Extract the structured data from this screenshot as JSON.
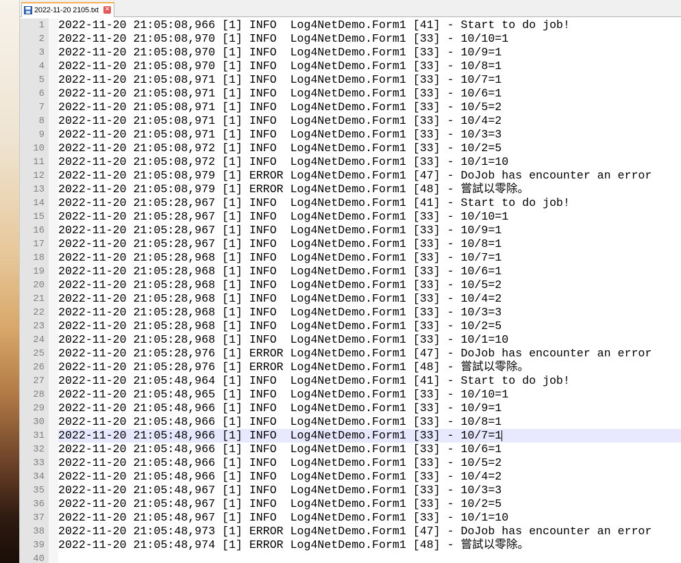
{
  "tab": {
    "title": "2022-11-20 2105.txt",
    "close_symbol": "✕"
  },
  "current_line": 31,
  "lines": [
    "2022-11-20 21:05:08,966 [1] INFO  Log4NetDemo.Form1 [41] - Start to do job!",
    "2022-11-20 21:05:08,970 [1] INFO  Log4NetDemo.Form1 [33] - 10/10=1",
    "2022-11-20 21:05:08,970 [1] INFO  Log4NetDemo.Form1 [33] - 10/9=1",
    "2022-11-20 21:05:08,970 [1] INFO  Log4NetDemo.Form1 [33] - 10/8=1",
    "2022-11-20 21:05:08,971 [1] INFO  Log4NetDemo.Form1 [33] - 10/7=1",
    "2022-11-20 21:05:08,971 [1] INFO  Log4NetDemo.Form1 [33] - 10/6=1",
    "2022-11-20 21:05:08,971 [1] INFO  Log4NetDemo.Form1 [33] - 10/5=2",
    "2022-11-20 21:05:08,971 [1] INFO  Log4NetDemo.Form1 [33] - 10/4=2",
    "2022-11-20 21:05:08,971 [1] INFO  Log4NetDemo.Form1 [33] - 10/3=3",
    "2022-11-20 21:05:08,972 [1] INFO  Log4NetDemo.Form1 [33] - 10/2=5",
    "2022-11-20 21:05:08,972 [1] INFO  Log4NetDemo.Form1 [33] - 10/1=10",
    "2022-11-20 21:05:08,979 [1] ERROR Log4NetDemo.Form1 [47] - DoJob has encounter an error",
    "2022-11-20 21:05:08,979 [1] ERROR Log4NetDemo.Form1 [48] - 嘗試以零除。",
    "2022-11-20 21:05:28,967 [1] INFO  Log4NetDemo.Form1 [41] - Start to do job!",
    "2022-11-20 21:05:28,967 [1] INFO  Log4NetDemo.Form1 [33] - 10/10=1",
    "2022-11-20 21:05:28,967 [1] INFO  Log4NetDemo.Form1 [33] - 10/9=1",
    "2022-11-20 21:05:28,967 [1] INFO  Log4NetDemo.Form1 [33] - 10/8=1",
    "2022-11-20 21:05:28,968 [1] INFO  Log4NetDemo.Form1 [33] - 10/7=1",
    "2022-11-20 21:05:28,968 [1] INFO  Log4NetDemo.Form1 [33] - 10/6=1",
    "2022-11-20 21:05:28,968 [1] INFO  Log4NetDemo.Form1 [33] - 10/5=2",
    "2022-11-20 21:05:28,968 [1] INFO  Log4NetDemo.Form1 [33] - 10/4=2",
    "2022-11-20 21:05:28,968 [1] INFO  Log4NetDemo.Form1 [33] - 10/3=3",
    "2022-11-20 21:05:28,968 [1] INFO  Log4NetDemo.Form1 [33] - 10/2=5",
    "2022-11-20 21:05:28,968 [1] INFO  Log4NetDemo.Form1 [33] - 10/1=10",
    "2022-11-20 21:05:28,976 [1] ERROR Log4NetDemo.Form1 [47] - DoJob has encounter an error",
    "2022-11-20 21:05:28,976 [1] ERROR Log4NetDemo.Form1 [48] - 嘗試以零除。",
    "2022-11-20 21:05:48,964 [1] INFO  Log4NetDemo.Form1 [41] - Start to do job!",
    "2022-11-20 21:05:48,965 [1] INFO  Log4NetDemo.Form1 [33] - 10/10=1",
    "2022-11-20 21:05:48,966 [1] INFO  Log4NetDemo.Form1 [33] - 10/9=1",
    "2022-11-20 21:05:48,966 [1] INFO  Log4NetDemo.Form1 [33] - 10/8=1",
    "2022-11-20 21:05:48,966 [1] INFO  Log4NetDemo.Form1 [33] - 10/7=1",
    "2022-11-20 21:05:48,966 [1] INFO  Log4NetDemo.Form1 [33] - 10/6=1",
    "2022-11-20 21:05:48,966 [1] INFO  Log4NetDemo.Form1 [33] - 10/5=2",
    "2022-11-20 21:05:48,966 [1] INFO  Log4NetDemo.Form1 [33] - 10/4=2",
    "2022-11-20 21:05:48,967 [1] INFO  Log4NetDemo.Form1 [33] - 10/3=3",
    "2022-11-20 21:05:48,967 [1] INFO  Log4NetDemo.Form1 [33] - 10/2=5",
    "2022-11-20 21:05:48,967 [1] INFO  Log4NetDemo.Form1 [33] - 10/1=10",
    "2022-11-20 21:05:48,973 [1] ERROR Log4NetDemo.Form1 [47] - DoJob has encounter an error",
    "2022-11-20 21:05:48,974 [1] ERROR Log4NetDemo.Form1 [48] - 嘗試以零除。",
    ""
  ]
}
